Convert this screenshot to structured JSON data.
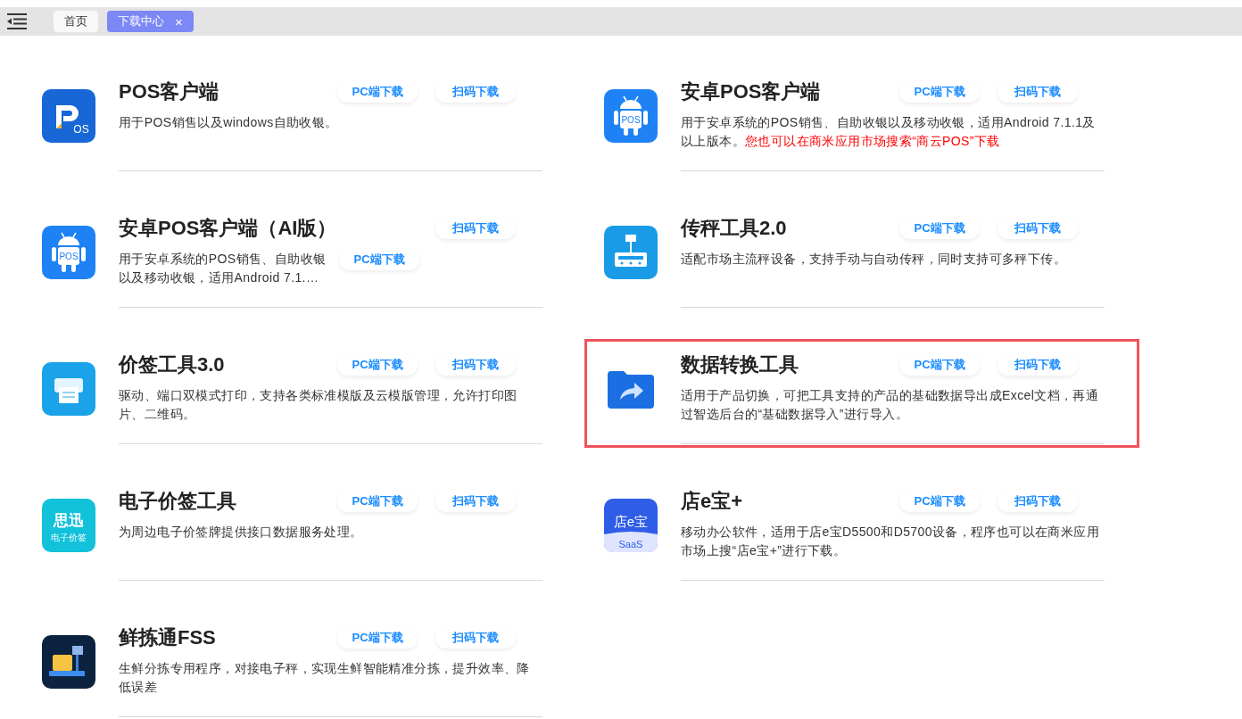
{
  "tabs": [
    {
      "label": "首页",
      "selected": false
    },
    {
      "label": "下载中心",
      "selected": true,
      "close": "×"
    }
  ],
  "items": [
    {
      "title": "POS客户端",
      "description": "用于POS销售以及windows自助收银。",
      "icon": {
        "kind": "pos",
        "texts": [
          "OS"
        ]
      },
      "buttons": [
        {
          "label": "PC端下载",
          "kind": "title_row"
        },
        {
          "label": "扫码下载",
          "kind": "title_row"
        }
      ]
    },
    {
      "title": "安卓POS客户端",
      "description": "用于安卓系统的POS销售、自助收银以及移动收银，适用Android 7.1.1及以上版本。",
      "note": "您也可以在商米应用市场搜索“商云POS”下载",
      "icon": {
        "kind": "android",
        "texts": [
          "POS"
        ]
      },
      "buttons": [
        {
          "label": "PC端下载",
          "kind": "title_row"
        },
        {
          "label": "扫码下载",
          "kind": "title_row"
        }
      ]
    },
    {
      "title": "安卓POS客户端（AI版）",
      "description": "用于安卓系统的POS销售、自助收银以及移动收银，适用Android 7.1.…",
      "icon": {
        "kind": "android",
        "texts": [
          "POS"
        ]
      },
      "buttons": [
        {
          "label": "扫码下载",
          "kind": "title_row"
        },
        {
          "label": "PC端下载",
          "kind": "description_row"
        }
      ]
    },
    {
      "title": "传秤工具2.0",
      "description": "适配市场主流秤设备，支持手动与自动传秤，同时支持可多秤下传。",
      "icon": {
        "kind": "scale"
      },
      "buttons": [
        {
          "label": "PC端下载",
          "kind": "title_row"
        },
        {
          "label": "扫码下载",
          "kind": "title_row"
        }
      ]
    },
    {
      "title": "价签工具3.0",
      "description": "驱动、端口双模式打印，支持各类标准模版及云模版管理，允许打印图片、二维码。",
      "icon": {
        "kind": "printer"
      },
      "buttons": [
        {
          "label": "PC端下载",
          "kind": "title_row"
        },
        {
          "label": "扫码下载",
          "kind": "title_row"
        }
      ]
    },
    {
      "title": "数据转换工具",
      "description": "适用于产品切换，可把工具支持的产品的基础数据导出成Excel文档，再通过智选后台的“基础数据导入”进行导入。",
      "highlighted": true,
      "icon": {
        "kind": "folder"
      },
      "buttons": [
        {
          "label": "PC端下载",
          "kind": "title_row"
        },
        {
          "label": "扫码下载",
          "kind": "title_row"
        }
      ]
    },
    {
      "title": "电子价签工具",
      "description": "为周边电子价签牌提供接口数据服务处理。",
      "icon": {
        "kind": "sixun",
        "texts": [
          "思迅",
          "电子价签"
        ]
      },
      "buttons": [
        {
          "label": "PC端下载",
          "kind": "title_row"
        },
        {
          "label": "扫码下载",
          "kind": "title_row"
        }
      ]
    },
    {
      "title": "店e宝+",
      "description": "移动办公软件，适用于店e宝D5500和D5700设备，程序也可以在商米应用市场上搜“店e宝+”进行下载。",
      "icon": {
        "kind": "dianbao",
        "texts": [
          "店e宝",
          "SaaS"
        ]
      },
      "buttons": [
        {
          "label": "PC端下载",
          "kind": "title_row"
        },
        {
          "label": "扫码下载",
          "kind": "title_row"
        }
      ]
    },
    {
      "title": "鲜拣通FSS",
      "description": "生鲜分拣专用程序，对接电子秤，实现生鲜智能精准分拣，提升效率、降低误差",
      "icon": {
        "kind": "fss"
      },
      "buttons": [
        {
          "label": "PC端下载",
          "kind": "title_row"
        },
        {
          "label": "扫码下载",
          "kind": "title_row"
        }
      ]
    }
  ]
}
